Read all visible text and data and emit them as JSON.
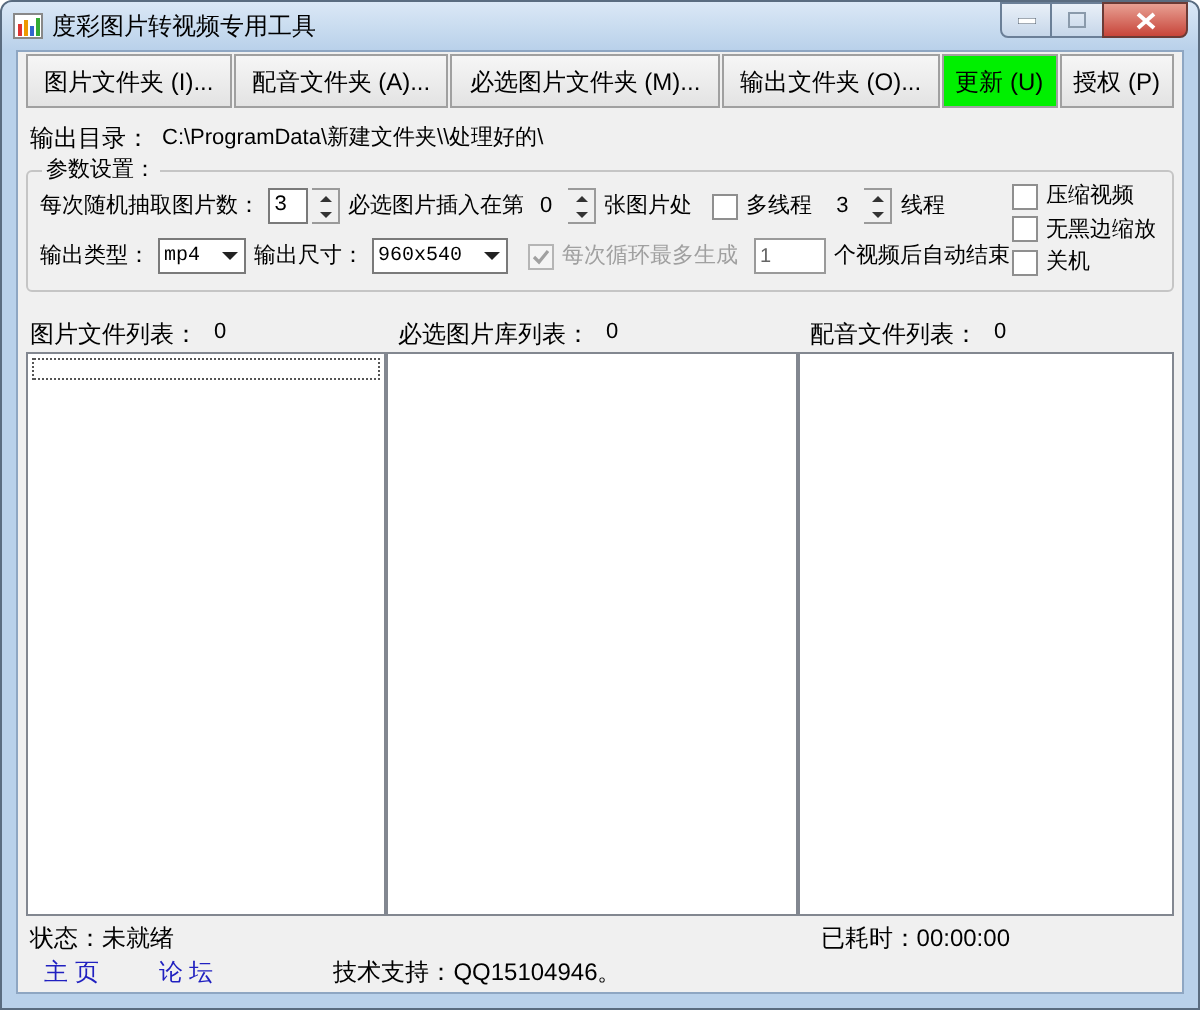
{
  "window": {
    "title": "度彩图片转视频专用工具"
  },
  "toolbar": [
    {
      "label": "图片文件夹 (I)...",
      "highlighted": false
    },
    {
      "label": "配音文件夹 (A)...",
      "highlighted": false
    },
    {
      "label": "必选图片文件夹 (M)...",
      "highlighted": false
    },
    {
      "label": "输出文件夹 (O)...",
      "highlighted": false
    },
    {
      "label": "更新 (U)",
      "highlighted": true
    },
    {
      "label": "授权 (P)",
      "highlighted": false
    }
  ],
  "output_dir": {
    "label": "输出目录：",
    "value": "C:\\ProgramData\\新建文件夹\\\\处理好的\\"
  },
  "params": {
    "legend": "参数设置：",
    "lines": [
      {
        "items": [
          {
            "kind": "label",
            "text": "每次随机抽取图片数："
          },
          {
            "kind": "spin_input",
            "value": "3"
          },
          {
            "kind": "label",
            "text": "必选图片插入在第"
          },
          {
            "kind": "spin_value",
            "value": "0"
          },
          {
            "kind": "label",
            "text": "张图片处"
          },
          {
            "kind": "checkbox",
            "label": "多线程",
            "checked": false,
            "disabled": false
          },
          {
            "kind": "spin_value",
            "value": "3"
          },
          {
            "kind": "label",
            "text": "线程"
          }
        ]
      },
      {
        "items": [
          {
            "kind": "label",
            "text": "输出类型："
          },
          {
            "kind": "select",
            "value": "mp4"
          },
          {
            "kind": "label",
            "text": "输出尺寸："
          },
          {
            "kind": "select",
            "value": "960x540"
          },
          {
            "kind": "checkbox",
            "label": "每次循环最多生成",
            "checked": true,
            "disabled": true
          },
          {
            "kind": "input",
            "value": "1"
          },
          {
            "kind": "label",
            "text": "个视频后自动结束"
          }
        ]
      }
    ],
    "options": [
      {
        "label": "压缩视频",
        "checked": false
      },
      {
        "label": "无黑边缩放",
        "checked": false
      },
      {
        "label": "关机",
        "checked": false
      }
    ]
  },
  "lists": [
    {
      "heading": "图片文件列表：",
      "count": "0",
      "focus_row": true
    },
    {
      "heading": "必选图片库列表：",
      "count": "0",
      "focus_row": false
    },
    {
      "heading": "配音文件列表：",
      "count": "0",
      "focus_row": false
    }
  ],
  "status": {
    "state": "状态：未就绪",
    "elapsed": "已耗时：00:00:00",
    "links": [
      "主 页",
      "论 坛"
    ],
    "support": "技术支持：QQ15104946。"
  }
}
